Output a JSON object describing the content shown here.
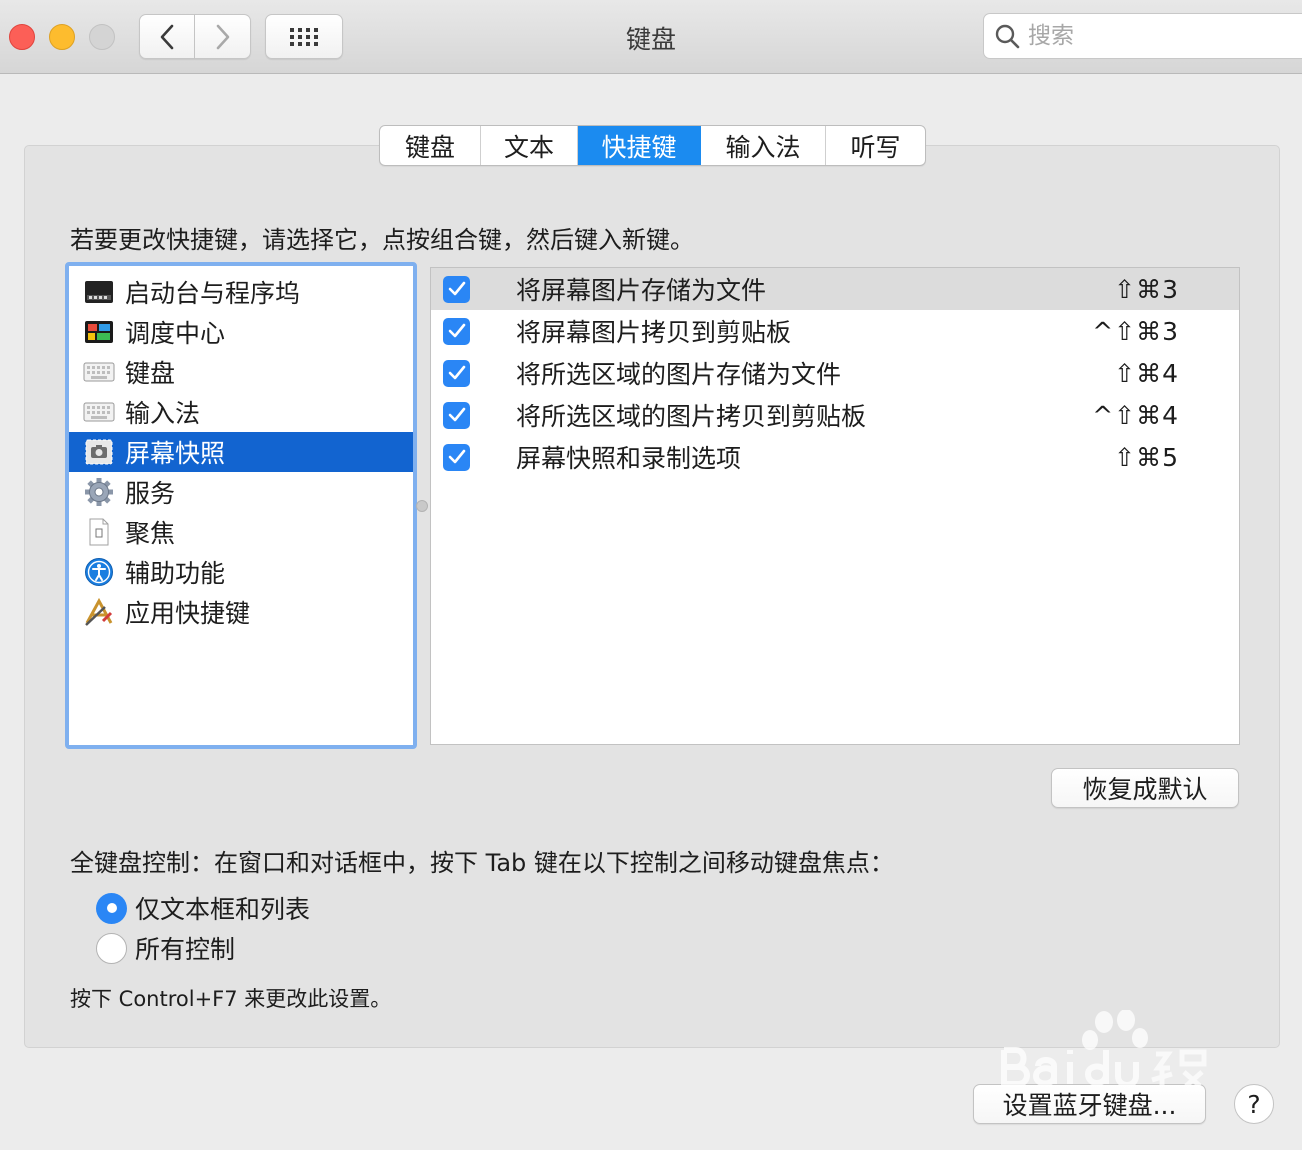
{
  "window": {
    "title": "键盘"
  },
  "search": {
    "placeholder": "搜索"
  },
  "tabs": [
    {
      "label": "键盘",
      "active": false
    },
    {
      "label": "文本",
      "active": false
    },
    {
      "label": "快捷键",
      "active": true
    },
    {
      "label": "输入法",
      "active": false
    },
    {
      "label": "听写",
      "active": false
    }
  ],
  "instruction": "若要更改快捷键，请选择它，点按组合键，然后键入新键。",
  "categories": [
    {
      "label": "启动台与程序坞",
      "icon": "launchpad-dock-icon",
      "selected": false
    },
    {
      "label": "调度中心",
      "icon": "mission-control-icon",
      "selected": false
    },
    {
      "label": "键盘",
      "icon": "keyboard-icon",
      "selected": false
    },
    {
      "label": "输入法",
      "icon": "input-method-icon",
      "selected": false
    },
    {
      "label": "屏幕快照",
      "icon": "screenshot-icon",
      "selected": true
    },
    {
      "label": "服务",
      "icon": "gear-icon",
      "selected": false
    },
    {
      "label": "聚焦",
      "icon": "spotlight-doc-icon",
      "selected": false
    },
    {
      "label": "辅助功能",
      "icon": "accessibility-icon",
      "selected": false
    },
    {
      "label": "应用快捷键",
      "icon": "app-shortcuts-icon",
      "selected": false
    }
  ],
  "shortcuts": [
    {
      "label": "将屏幕图片存储为文件",
      "key": "⇧⌘3",
      "checked": true,
      "highlighted": true
    },
    {
      "label": "将屏幕图片拷贝到剪贴板",
      "key": "^⇧⌘3",
      "checked": true,
      "highlighted": false
    },
    {
      "label": "将所选区域的图片存储为文件",
      "key": "⇧⌘4",
      "checked": true,
      "highlighted": false
    },
    {
      "label": "将所选区域的图片拷贝到剪贴板",
      "key": "^⇧⌘4",
      "checked": true,
      "highlighted": false
    },
    {
      "label": "屏幕快照和录制选项",
      "key": "⇧⌘5",
      "checked": true,
      "highlighted": false
    }
  ],
  "restore_button": "恢复成默认",
  "full_keyboard": {
    "title": "全键盘控制：在窗口和对话框中，按下 Tab 键在以下控制之间移动键盘焦点：",
    "options": [
      {
        "label": "仅文本框和列表",
        "selected": true
      },
      {
        "label": "所有控制",
        "selected": false
      }
    ],
    "hint": "按下 Control+F7 来更改此设置。"
  },
  "bluetooth_button": "设置蓝牙键盘...",
  "help_button": "?",
  "colors": {
    "accent": "#1b8bf0",
    "selection": "#1264d0",
    "checkbox": "#2a86f5"
  }
}
